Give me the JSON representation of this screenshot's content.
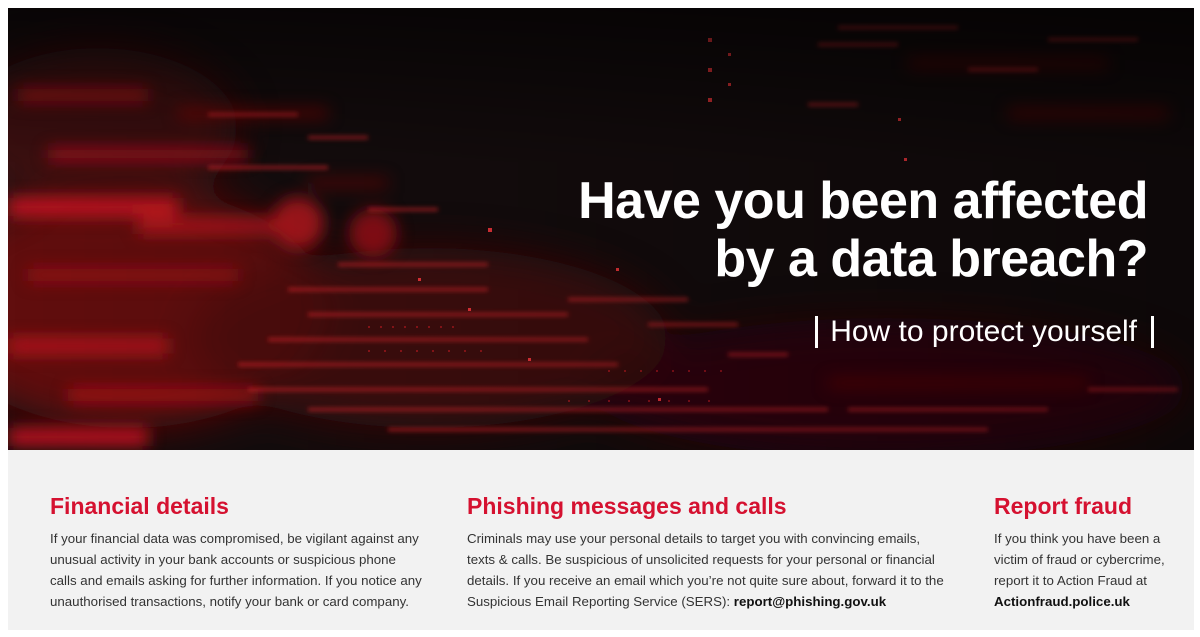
{
  "hero": {
    "headline_line1": "Have you been affected",
    "headline_line2": "by a data breach?",
    "subheading": "How to protect yourself"
  },
  "sections": [
    {
      "title": "Financial details",
      "lines": [
        "If your financial data was compromised, be vigilant against any",
        "unusual activity in your bank accounts or suspicious phone",
        "calls and emails asking for further information. If you notice any",
        "unauthorised transactions, notify your bank or card company."
      ]
    },
    {
      "title": "Phishing messages and calls",
      "lines": [
        "Criminals may use your personal details to target you with convincing emails,",
        "texts & calls. Be suspicious of unsolicited requests for your personal or financial",
        "details. If you receive an email which you’re not quite sure about, forward it to the",
        "Suspicious Email Reporting Service (SERS): "
      ],
      "email": "report@phishing.gov.uk"
    },
    {
      "title": "Report fraud",
      "lines": [
        "If you think you have been a",
        "victim of fraud or cybercrime,",
        "report it to Action Fraud at"
      ],
      "link": "Actionfraud.police.uk"
    }
  ],
  "colors": {
    "accent_red": "#d51130",
    "hero_dark": "#120c0d",
    "panel_grey": "#f2f2f2"
  }
}
